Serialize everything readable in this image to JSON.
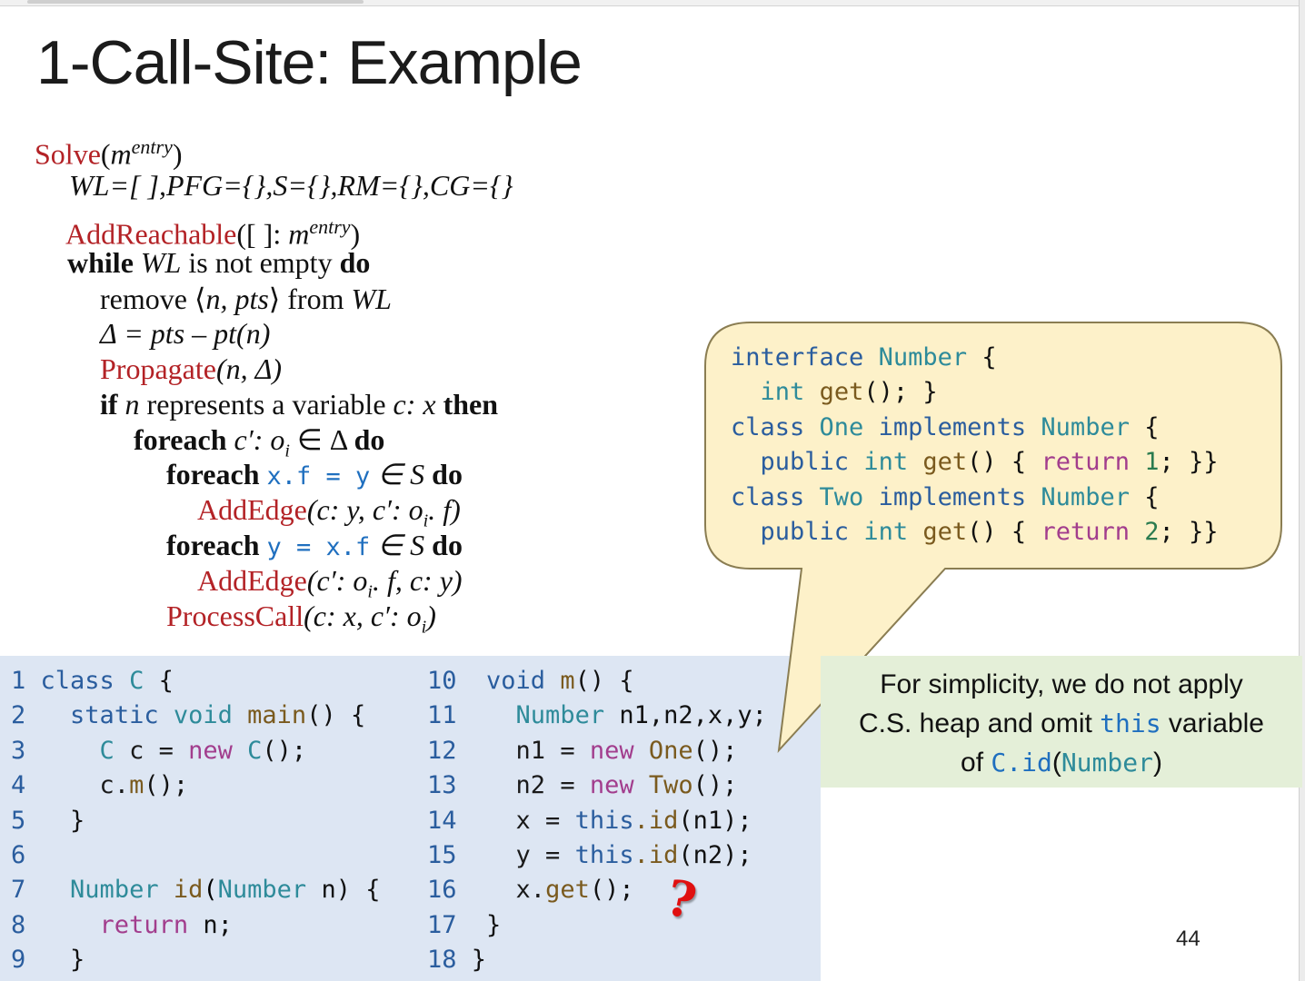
{
  "slide": {
    "title": "1-Call-Site: Example",
    "page_number": "44"
  },
  "algorithm": {
    "solve_fn": "Solve",
    "solve_arg": "m",
    "solve_sup": "entry",
    "init_line": "WL=[ ],PFG={},S={},RM={},CG={}",
    "add_reachable_fn": "AddReachable",
    "add_reachable_arg": "([ ]: ",
    "add_reachable_m": "m",
    "add_reachable_sup": "entry",
    "while_kw": "while",
    "while_wl": "WL",
    "while_text": " is not empty ",
    "do_kw": "do",
    "remove_text": "remove ⟨",
    "remove_vars": "n, pts",
    "remove_from": "⟩ from ",
    "remove_wl": "WL",
    "delta_line": "Δ = pts – pt(n)",
    "propagate_fn": "Propagate",
    "propagate_args": "(n, Δ)",
    "if_kw": "if",
    "if_n": "n",
    "if_text": " represents a variable ",
    "if_cx": "c: x",
    "then_kw": "then",
    "foreach_kw": "foreach",
    "foreach1_var": "c′: o",
    "foreach1_sub": "i",
    "foreach1_rest": " ∈ Δ ",
    "foreach2_code": "x.f = y",
    "foreach2_rest": "∈ S ",
    "addedge1_fn": "AddEdge",
    "addedge1_args": "(c: y, c′: o",
    "addedge1_sub": "i",
    "addedge1_end": ". f)",
    "foreach3_code": "y = x.f",
    "foreach3_rest": "∈ S ",
    "addedge2_fn": "AddEdge",
    "addedge2_args": "(c′: o",
    "addedge2_sub": "i",
    "addedge2_end": ". f, c: y)",
    "processcall_fn": "ProcessCall",
    "processcall_args": "(c: x, c′: o",
    "processcall_sub": "i",
    "processcall_end": ")"
  },
  "callout": {
    "l1_kw": "interface",
    "l1_type": "Number",
    "l1_end": " {",
    "l2_kw": "int",
    "l2_fn": "get",
    "l2_end": "(); }",
    "l3_kw": "class",
    "l3_type": "One",
    "l3_impl": "implements",
    "l3_type2": "Number",
    "l3_end": " {",
    "l4_kw1": "public",
    "l4_kw2": "int",
    "l4_fn": "get",
    "l4_mid": "() { ",
    "l4_ret": "return",
    "l4_num": "1",
    "l4_end": "; }}",
    "l5_kw": "class",
    "l5_type": "Two",
    "l5_impl": "implements",
    "l5_type2": "Number",
    "l5_end": " {",
    "l6_kw1": "public",
    "l6_kw2": "int",
    "l6_fn": "get",
    "l6_mid": "() { ",
    "l6_ret": "return",
    "l6_num": "2",
    "l6_end": "; }}"
  },
  "note": {
    "line1": "For simplicity, we do not apply",
    "line2_a": "C.S. heap and omit ",
    "line2_code": "this",
    "line2_b": " variable",
    "line3_a": "of ",
    "line3_code1": "C.id",
    "line3_paren1": "(",
    "line3_code2": "Number",
    "line3_paren2": ")"
  },
  "code_left": {
    "line_numbers": [
      "1",
      "2",
      "3",
      "4",
      "5",
      "6",
      "7",
      "8",
      "9"
    ],
    "l1_kw": "class",
    "l1_type": "C",
    "l1_end": " {",
    "l2_kw1": "static",
    "l2_kw2": "void",
    "l2_fn": "main",
    "l2_end": "() {",
    "l3_type": "C",
    "l3_var": " c = ",
    "l3_new": "new",
    "l3_ctor": "C",
    "l3_end": "();",
    "l4_obj": "c.",
    "l4_fn": "m",
    "l4_end": "();",
    "l5": "}",
    "l7_type": "Number",
    "l7_fn": "id",
    "l7_type2": "Number",
    "l7_end": " n) {",
    "l8_ret": "return",
    "l8_end": " n;",
    "l9": "}"
  },
  "code_right": {
    "line_numbers": [
      "10",
      "11",
      "12",
      "13",
      "14",
      "15",
      "16",
      "17",
      "18"
    ],
    "l10_kw": "void",
    "l10_fn": "m",
    "l10_end": "() {",
    "l11_type": "Number",
    "l11_end": " n1,n2,x,y;",
    "l12_a": "n1 = ",
    "l12_new": "new",
    "l12_type": "One",
    "l12_end": "();",
    "l13_a": "n2 = ",
    "l13_new": "new",
    "l13_type": "Two",
    "l13_end": "();",
    "l14_a": "x = ",
    "l14_this": "this",
    "l14_fn": ".id",
    "l14_end": "(n1);",
    "l15_a": "y = ",
    "l15_this": "this",
    "l15_fn": ".id",
    "l15_end": "(n2);",
    "l16_a": "x.",
    "l16_fn": "get",
    "l16_end": "();",
    "l17": "}",
    "l18": "}",
    "question_mark": "?"
  }
}
